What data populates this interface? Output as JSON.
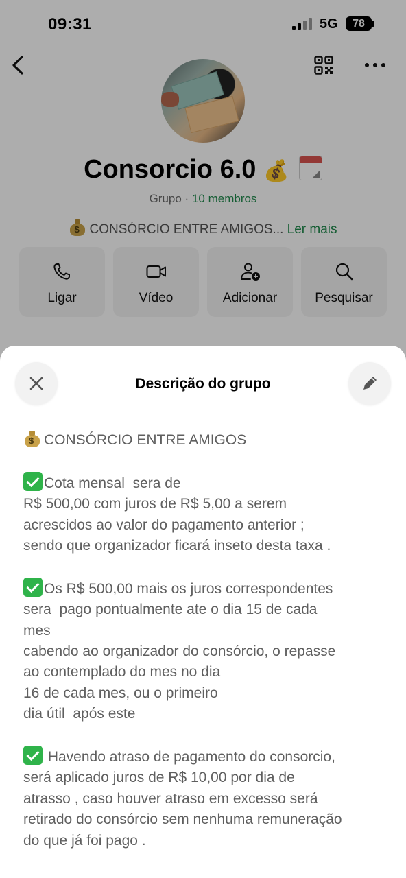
{
  "status": {
    "time": "09:31",
    "network": "5G",
    "battery": "78"
  },
  "group": {
    "name": "Consorcio 6.0",
    "name_emoji": "💰",
    "type": "Grupo",
    "separator": "·",
    "members": "10 membros",
    "description_preview": "CONSÓRCIO ENTRE AMIGOS...",
    "read_more": "Ler mais"
  },
  "actions": [
    {
      "label": "Ligar",
      "icon": "phone-icon"
    },
    {
      "label": "Vídeo",
      "icon": "video-icon"
    },
    {
      "label": "Adicionar",
      "icon": "add-person-icon"
    },
    {
      "label": "Pesquisar",
      "icon": "search-icon"
    }
  ],
  "sheet": {
    "title": "Descrição do grupo",
    "heading": "CONSÓRCIO ENTRE AMIGOS",
    "paragraphs": [
      [
        "Cota mensal  sera de",
        "R$ 500,00 com juros de R$ 5,00 a serem",
        "acrescidos ao valor do pagamento anterior ;",
        "sendo que organizador ficará inseto desta taxa ."
      ],
      [
        "Os R$ 500,00 mais os juros correspondentes",
        "sera  pago pontualmente ate o dia 15 de cada",
        "mes",
        "cabendo ao organizador do consórcio, o repasse",
        "ao contemplado do mes no dia",
        "16 de cada mes, ou o primeiro",
        "dia útil  após este"
      ],
      [
        " Havendo atraso de pagamento do consorcio,",
        "será aplicado juros de R$ 10,00 por dia de",
        "atrasso , caso houver atraso em excesso será",
        "retirado do consórcio sem nenhuma remuneração",
        "do que já foi pago ."
      ]
    ]
  },
  "colors": {
    "accent_green": "#1f8a4c",
    "check_green": "#2fb34a"
  }
}
